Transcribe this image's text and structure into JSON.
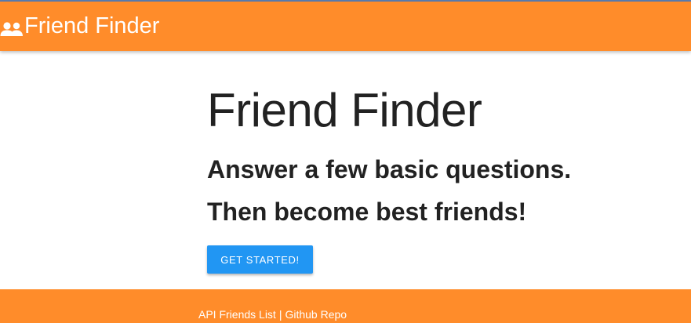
{
  "navbar": {
    "brand_icon": "people-icon",
    "brand_text": "Friend Finder"
  },
  "hero": {
    "title": "Friend Finder",
    "line1": "Answer a few basic questions.",
    "line2": "Then become best friends!",
    "cta_label": "GET STARTED!"
  },
  "footer": {
    "link_api": "API Friends List",
    "separator": "|",
    "link_github": "Github Repo"
  },
  "colors": {
    "accent": "#ff8c2a",
    "button": "#2196f3",
    "text": "#222222"
  }
}
